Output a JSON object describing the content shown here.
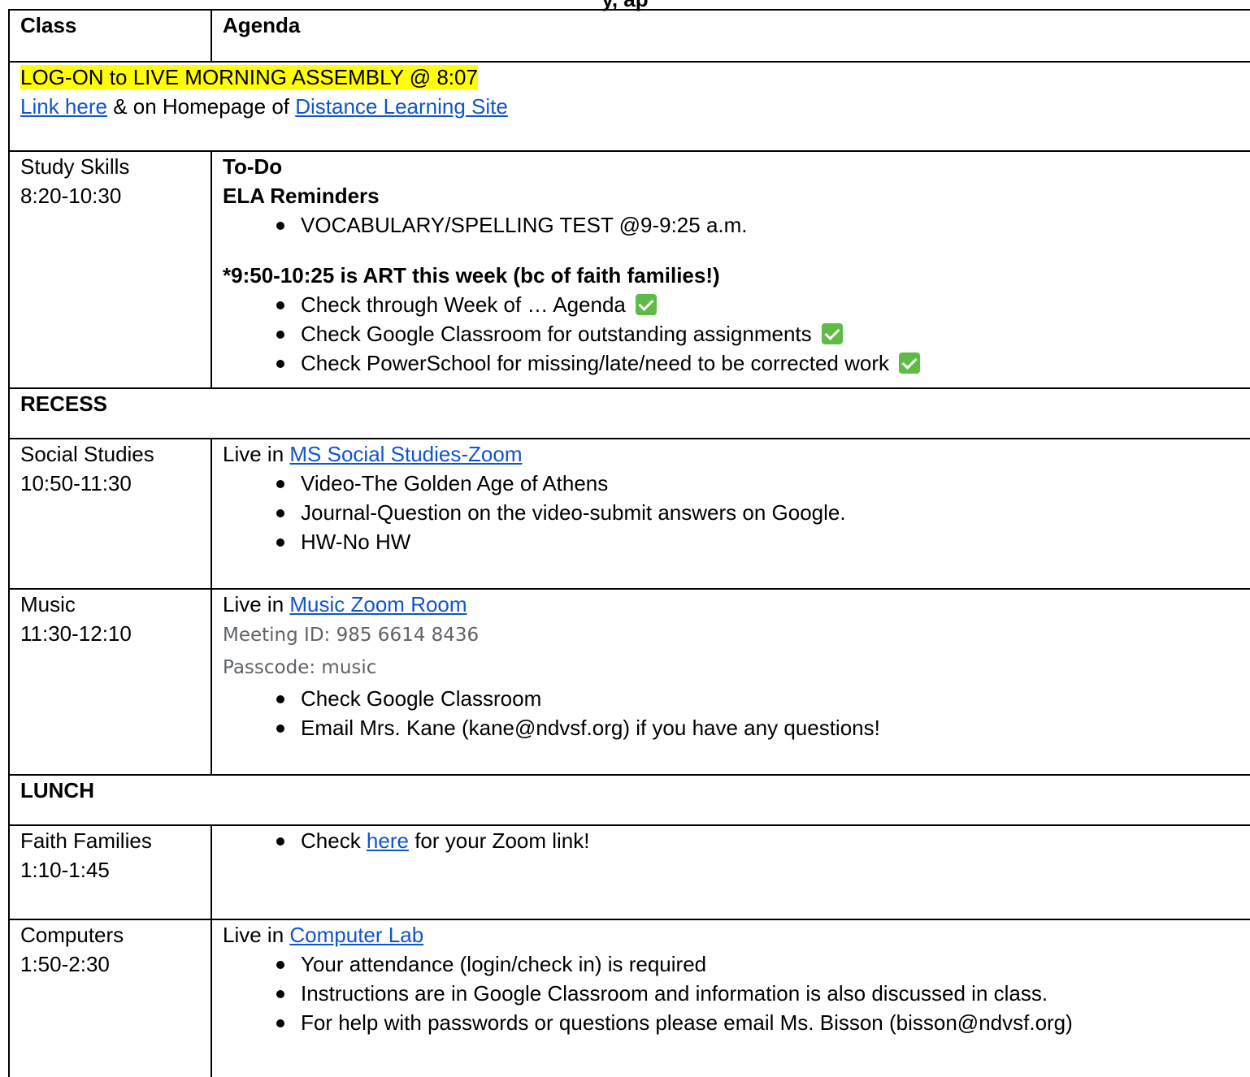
{
  "header": {
    "title_partial": "y, ap",
    "col_class": "Class",
    "col_agenda": "Agenda"
  },
  "assembly": {
    "line1": "LOG-ON to LIVE MORNING ASSEMBLY @ 8:07",
    "link_here": "Link here",
    "mid_text": " & on Homepage of ",
    "link_site": "Distance Learning Site"
  },
  "rows": {
    "study": {
      "name": "Study Skills",
      "time": "8:20-10:30",
      "todo": "To-Do",
      "ela": "ELA Reminders",
      "ela_items": [
        "VOCABULARY/SPELLING TEST @9-9:25 a.m."
      ],
      "art_note": "*9:50-10:25 is ART this week (bc of faith families!)",
      "art_items": [
        "Check through Week of … Agenda",
        "Check Google Classroom for outstanding assignments",
        "Check PowerSchool for missing/late/need to be corrected work"
      ],
      "check_icon": "check-mark-button-icon",
      "check_color": "#5dbb46"
    },
    "recess": {
      "label": "RECESS"
    },
    "social": {
      "name": "Social Studies",
      "time": "10:50-11:30",
      "live_in": "Live in ",
      "link": "MS Social Studies-Zoom",
      "items": [
        "Video-The Golden Age of Athens",
        "Journal-Question on the video-submit answers on Google.",
        "HW-No HW"
      ]
    },
    "music": {
      "name": "Music",
      "time": "11:30-12:10",
      "live_in": "Live in ",
      "link": "Music Zoom Room",
      "meeting_id": "Meeting ID: 985 6614 8436",
      "passcode": "Passcode: music",
      "items": [
        "Check Google Classroom",
        "Email Mrs. Kane (kane@ndvsf.org) if you have any questions!"
      ]
    },
    "lunch": {
      "label": "LUNCH"
    },
    "faith": {
      "name": "Faith Families",
      "time": "1:10-1:45",
      "pre": "Check ",
      "link": "here",
      "post": " for your Zoom link!"
    },
    "computers": {
      "name": "Computers",
      "time": "1:50-2:30",
      "live_in": "Live in ",
      "link": "Computer Lab",
      "items": [
        "Your attendance (login/check in) is required",
        "Instructions are in Google Classroom and information is also discussed in class.",
        "For help with passwords or questions please email Ms. Bisson (bisson@ndvsf.org)"
      ]
    }
  },
  "colors": {
    "link": "#1155cc",
    "highlight": "#ffff00",
    "meta_text": "#5f6368"
  }
}
